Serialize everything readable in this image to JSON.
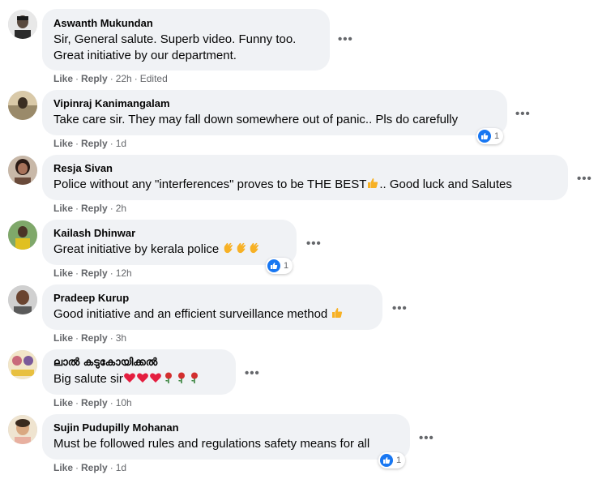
{
  "comments": [
    {
      "author": "Aswanth Mukundan",
      "lines": [
        "Sir, General salute. Superb video. Funny too.",
        "Great initiative by our department."
      ],
      "like": "Like",
      "reply": "Reply",
      "time": "22h",
      "edited": "Edited",
      "reactions": null
    },
    {
      "author": "Vipinraj Kanimangalam",
      "lines": [
        "Take care sir. They may fall down somewhere out of panic.. Pls do carefully"
      ],
      "like": "Like",
      "reply": "Reply",
      "time": "1d",
      "reactions": "1"
    },
    {
      "author": "Resja Sivan",
      "lines": [
        "Police without any \"interferences\" proves to be THE BEST",
        ".. Good luck and Salutes"
      ],
      "like": "Like",
      "reply": "Reply",
      "time": "2h",
      "reactions": null
    },
    {
      "author": "Kailash Dhinwar",
      "lines": [
        "Great initiative by kerala police "
      ],
      "like": "Like",
      "reply": "Reply",
      "time": "12h",
      "reactions": "1"
    },
    {
      "author": "Pradeep Kurup",
      "lines": [
        "Good initiative and an efficient surveillance method "
      ],
      "like": "Like",
      "reply": "Reply",
      "time": "3h",
      "reactions": null
    },
    {
      "author": "ലാൽ കടുകോയിക്കൽ",
      "lines": [
        "Big salute sir"
      ],
      "like": "Like",
      "reply": "Reply",
      "time": "10h",
      "reactions": null
    },
    {
      "author": "Sujin Pudupilly Mohanan",
      "lines": [
        "Must be followed rules and regulations safety means for all"
      ],
      "like": "Like",
      "reply": "Reply",
      "time": "1d",
      "reactions": "1"
    }
  ],
  "more_icon": "more-options-icon",
  "reaction_icon": "like-reaction-icon",
  "colors": {
    "bubble": "#f0f2f5",
    "meta": "#65676b",
    "like_blue": "#1877f2",
    "heart": "#e41e3f",
    "rose": "#d32f2f",
    "thumb": "#f7b125"
  }
}
